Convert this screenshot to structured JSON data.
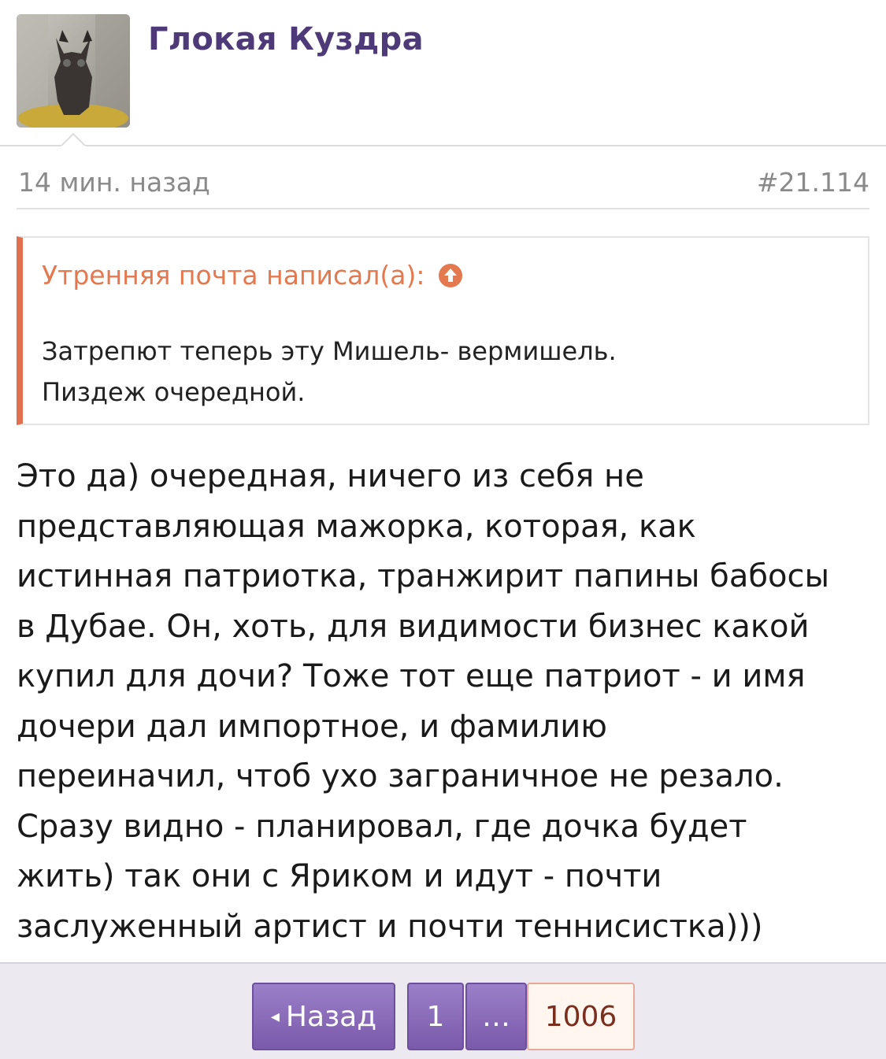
{
  "post": {
    "author": "Глокая Куздра",
    "time": "14 мин. назад",
    "number": "#21.114",
    "quote": {
      "author_line": "Утренняя почта написал(а):",
      "lines": [
        "Затрепют теперь эту Мишель- вермишель.",
        "Пиздеж очередной."
      ]
    },
    "body_lines": [
      "Это да) очередная, ничего из себя не",
      "представляющая мажорка, которая, как",
      "истинная патриотка, транжирит папины бабосы",
      "в Дубае. Он, хоть, для видимости бизнес какой",
      "купил для дочи? Тоже тот еще патриот - и имя",
      "дочери дал импортное, и фамилию",
      "переиначил, чтоб ухо заграничное не резало.",
      "Сразу видно - планировал, где дочка будет",
      "жить) так они с Яриком и идут - почти",
      "заслуженный артист и почти теннисистка)))"
    ]
  },
  "pagination": {
    "prev_label": "Назад",
    "first": "1",
    "ellipsis": "…",
    "current": "1006"
  },
  "colors": {
    "username": "#4e3a78",
    "quote_accent": "#e07050",
    "pager_purple": "#7a5aab",
    "meta_gray": "#8a8a8a"
  },
  "icons": [
    "avatar",
    "arrow-up-circle-icon",
    "chevron-left-icon"
  ]
}
